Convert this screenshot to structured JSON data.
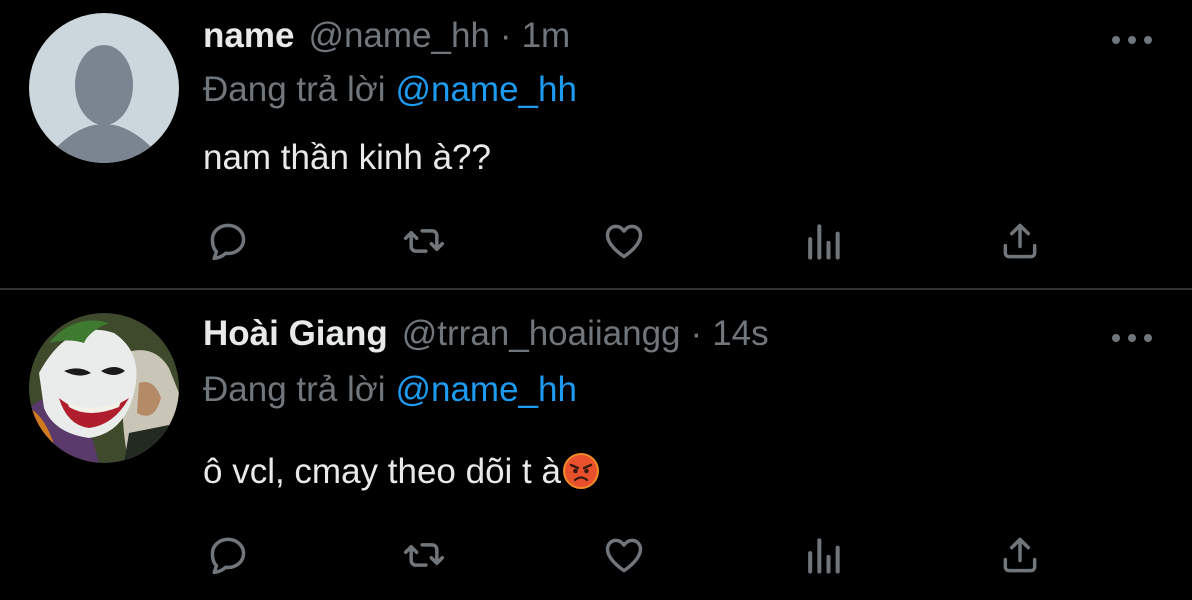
{
  "colors": {
    "background": "#000000",
    "text_primary": "#e7e9ea",
    "text_secondary": "#71767b",
    "accent": "#1d9bf0",
    "divider": "#2f3336"
  },
  "tweets": [
    {
      "display_name": "name",
      "handle": "@name_hh",
      "separator": "·",
      "time": "1m",
      "reply_prefix": "Đang trả lời",
      "reply_to": "@name_hh",
      "text": "nam thần kinh à??",
      "avatar": "default-avatar-icon"
    },
    {
      "display_name": "Hoài Giang",
      "handle": "@trran_hoaiiangg",
      "separator": "·",
      "time": "14s",
      "reply_prefix": "Đang trả lời",
      "reply_to": "@name_hh",
      "text": "ô vcl, cmay theo dõi t à",
      "emoji": "angry-face-emoji",
      "avatar": "joker-avatar"
    }
  ],
  "actions": [
    "reply-icon",
    "retweet-icon",
    "like-icon",
    "analytics-icon",
    "share-icon"
  ]
}
